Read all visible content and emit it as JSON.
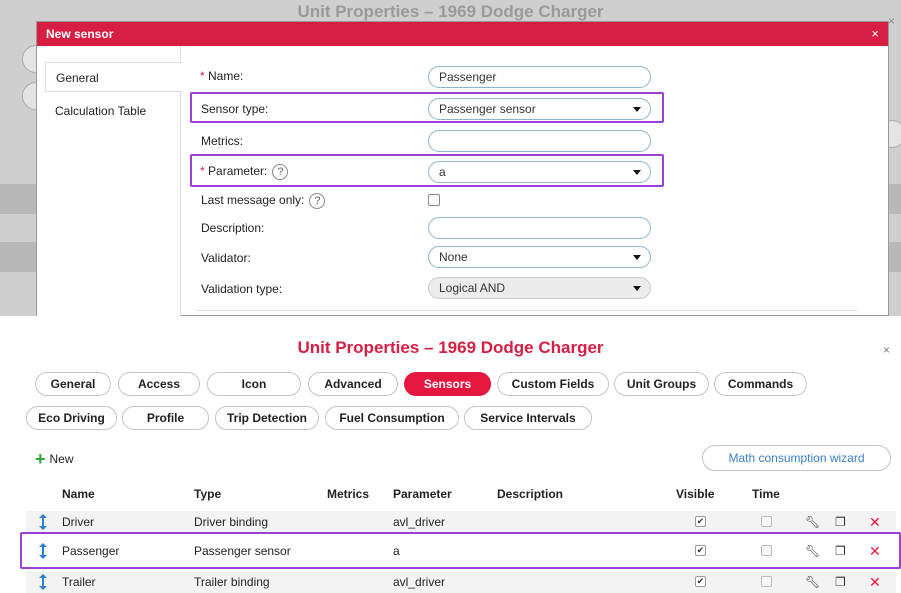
{
  "top_dialog": {
    "background_title": "Unit Properties – 1969 Dodge Charger",
    "title": "New sensor",
    "close": "×",
    "tabs": [
      "General",
      "Calculation Table"
    ],
    "fields": {
      "name": {
        "label": "Name:",
        "required": "*",
        "value": "Passenger"
      },
      "sensor_type": {
        "label": "Sensor type:",
        "value": "Passenger sensor"
      },
      "metrics": {
        "label": "Metrics:",
        "value": ""
      },
      "parameter": {
        "label": "Parameter:",
        "required": "*",
        "help": "?",
        "value": "a"
      },
      "last_message_only": {
        "label": "Last message only:",
        "help": "?",
        "checked": false
      },
      "description": {
        "label": "Description:",
        "value": ""
      },
      "validator": {
        "label": "Validator:",
        "value": "None"
      },
      "validation_type": {
        "label": "Validation type:",
        "value": "Logical AND"
      }
    }
  },
  "unit_properties": {
    "title": "Unit Properties – 1969 Dodge Charger",
    "close": "×",
    "tabs_row1": [
      "General",
      "Access",
      "Icon",
      "Advanced",
      "Sensors",
      "Custom Fields",
      "Unit Groups",
      "Commands"
    ],
    "tabs_row2": [
      "Eco Driving",
      "Profile",
      "Trip Detection",
      "Fuel Consumption",
      "Service Intervals"
    ],
    "active_tab": "Sensors",
    "new_label": "New",
    "wizard_label": "Math consumption wizard",
    "columns": [
      "Name",
      "Type",
      "Metrics",
      "Parameter",
      "Description",
      "Visible",
      "Time"
    ],
    "rows": [
      {
        "name": "Driver",
        "type": "Driver binding",
        "metrics": "",
        "parameter": "avl_driver",
        "description": "",
        "visible": true,
        "time": false
      },
      {
        "name": "Passenger",
        "type": "Passenger sensor",
        "metrics": "",
        "parameter": "a",
        "description": "",
        "visible": true,
        "time": false
      },
      {
        "name": "Trailer",
        "type": "Trailer binding",
        "metrics": "",
        "parameter": "avl_driver",
        "description": "",
        "visible": true,
        "time": false
      }
    ],
    "icons": {
      "edit": "wrench-icon",
      "copy": "copy-icon",
      "delete": "delete-icon"
    },
    "accent_color": "#e5173f"
  }
}
